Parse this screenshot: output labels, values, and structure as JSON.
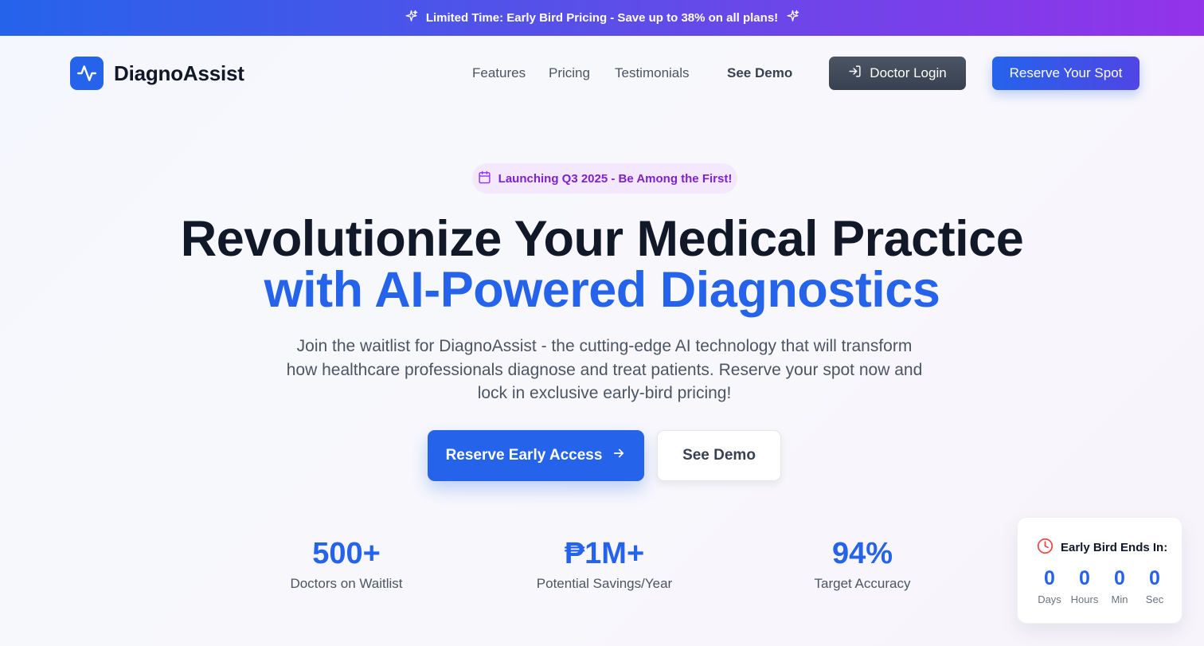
{
  "promo": {
    "text": "Limited Time: Early Bird Pricing - Save up to 38% on all plans!",
    "icon": "sparkles-icon"
  },
  "nav": {
    "brand": "DiagnoAssist",
    "brand_icon": "activity-pulse-icon",
    "links": [
      "Features",
      "Pricing",
      "Testimonials"
    ],
    "see_demo": "See Demo",
    "login_label": "Doctor Login",
    "login_icon": "log-in-icon",
    "reserve_label": "Reserve Your Spot"
  },
  "hero": {
    "badge": "Launching Q3 2025 - Be Among the First!",
    "badge_icon": "calendar-icon",
    "title_line1": "Revolutionize Your Medical Practice",
    "title_line2": "with AI-Powered Diagnostics",
    "subtitle": "Join the waitlist for DiagnoAssist - the cutting-edge AI technology that will transform how healthcare professionals diagnose and treat patients. Reserve your spot now and lock in exclusive early-bird pricing!",
    "cta_primary": "Reserve Early Access",
    "cta_primary_icon": "arrow-right-icon",
    "cta_secondary": "See Demo"
  },
  "stats": [
    {
      "value": "500+",
      "label": "Doctors on Waitlist"
    },
    {
      "value": "₱1M+",
      "label": "Potential Savings/Year"
    },
    {
      "value": "94%",
      "label": "Target Accuracy"
    }
  ],
  "countdown": {
    "title": "Early Bird Ends In:",
    "icon": "clock-icon",
    "units": [
      {
        "value": "0",
        "label": "Days"
      },
      {
        "value": "0",
        "label": "Hours"
      },
      {
        "value": "0",
        "label": "Min"
      },
      {
        "value": "0",
        "label": "Sec"
      }
    ]
  },
  "colors": {
    "primary": "#2563eb",
    "purple_accent": "#9333ea",
    "badge_bg": "#f3e8fd",
    "badge_text": "#7e22ce",
    "dark_button": "#374151",
    "clock_red": "#ef4444"
  }
}
